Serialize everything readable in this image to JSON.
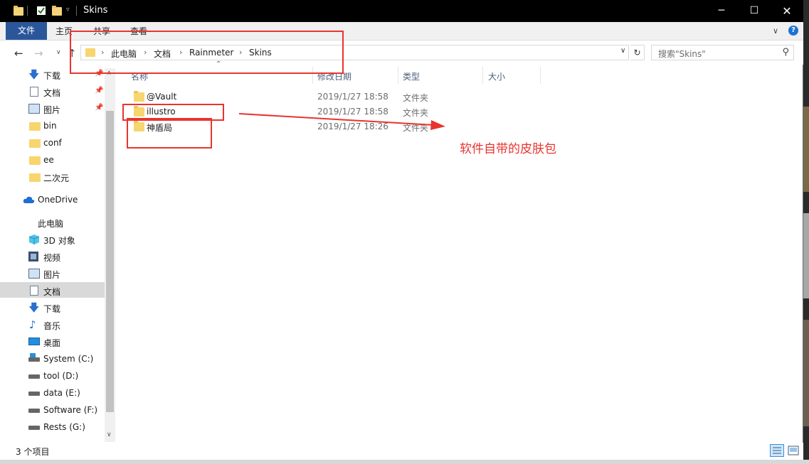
{
  "window": {
    "title": "Skins"
  },
  "ribbon": {
    "tabs": [
      "文件",
      "主页",
      "共享",
      "查看"
    ]
  },
  "address": {
    "crumbs": [
      "此电脑",
      "文档",
      "Rainmeter",
      "Skins"
    ],
    "search_placeholder": "搜索\"Skins\""
  },
  "sidebar": {
    "items": [
      {
        "label": "下载",
        "icon": "download-arrow-icon",
        "pinned": true
      },
      {
        "label": "文档",
        "icon": "document-icon",
        "pinned": true
      },
      {
        "label": "图片",
        "icon": "pictures-icon",
        "pinned": true
      },
      {
        "label": "bin",
        "icon": "folder-icon"
      },
      {
        "label": "conf",
        "icon": "folder-icon"
      },
      {
        "label": "ee",
        "icon": "folder-icon"
      },
      {
        "label": "二次元",
        "icon": "folder-icon"
      },
      {
        "label": "OneDrive",
        "icon": "onedrive-cloud-icon"
      },
      {
        "label": "此电脑",
        "icon": "this-pc-icon"
      },
      {
        "label": "3D 对象",
        "icon": "3d-objects-icon"
      },
      {
        "label": "视频",
        "icon": "video-icon"
      },
      {
        "label": "图片",
        "icon": "pictures-icon"
      },
      {
        "label": "文档",
        "icon": "document-icon",
        "selected": true
      },
      {
        "label": "下载",
        "icon": "download-arrow-icon"
      },
      {
        "label": "音乐",
        "icon": "music-note-icon"
      },
      {
        "label": "桌面",
        "icon": "desktop-icon"
      },
      {
        "label": "System (C:)",
        "icon": "system-drive-icon"
      },
      {
        "label": "tool (D:)",
        "icon": "drive-icon"
      },
      {
        "label": "data (E:)",
        "icon": "drive-icon"
      },
      {
        "label": "Software (F:)",
        "icon": "drive-icon"
      },
      {
        "label": "Rests (G:)",
        "icon": "drive-icon"
      }
    ]
  },
  "columns": [
    "名称",
    "修改日期",
    "类型",
    "大小"
  ],
  "files": [
    {
      "name": "@Vault",
      "date": "2019/1/27 18:58",
      "type": "文件夹"
    },
    {
      "name": "illustro",
      "date": "2019/1/27 18:58",
      "type": "文件夹"
    },
    {
      "name": "神盾局",
      "date": "2019/1/27 18:26",
      "type": "文件夹"
    }
  ],
  "annotation": {
    "text": "软件自带的皮肤包",
    "color": "#e8342e"
  },
  "status": {
    "item_count": "3 个项目"
  },
  "colors": {
    "file_tab": "#2b579a",
    "folder": "#f7d56f",
    "selection": "#d9d9d9"
  }
}
